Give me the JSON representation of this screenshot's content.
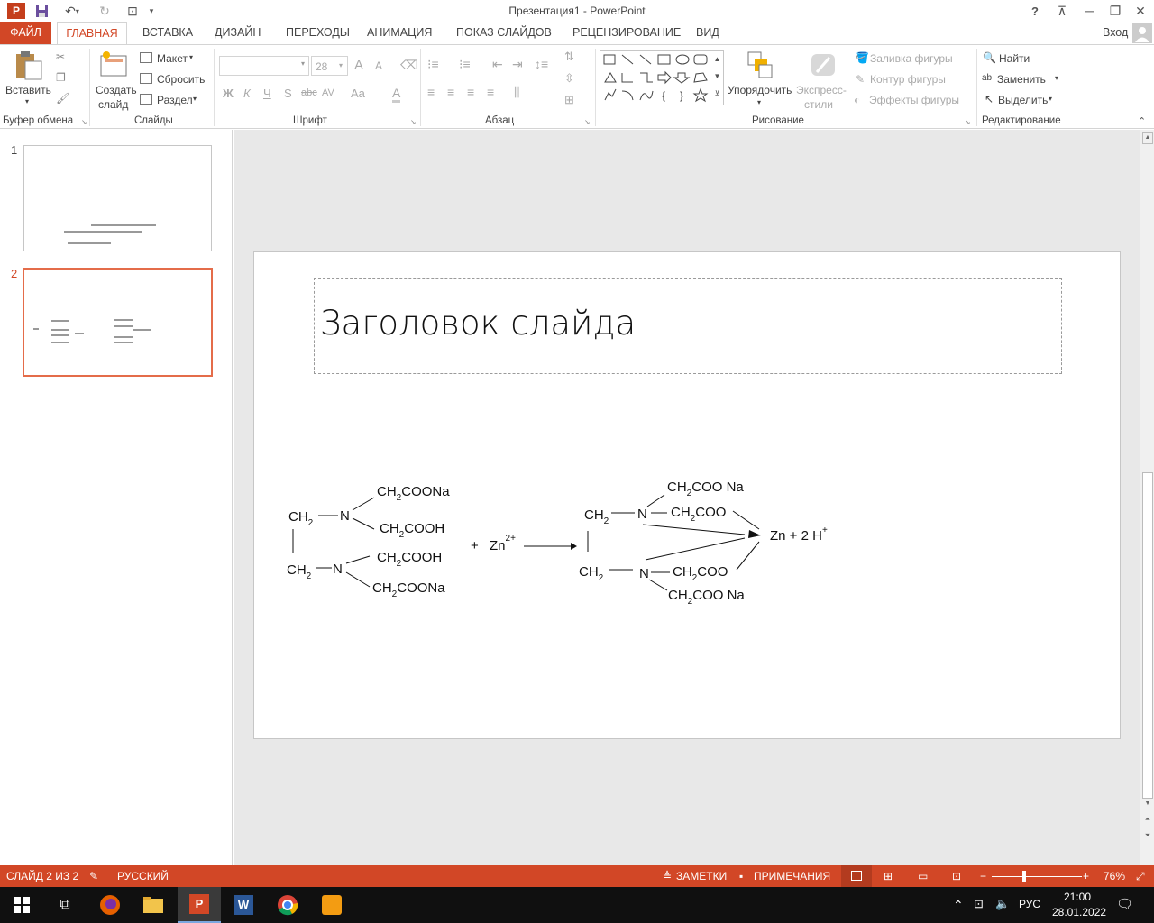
{
  "window": {
    "title": "Презентация1 - PowerPoint",
    "help": "?",
    "minimize": "─",
    "restore": "❐",
    "close": "✕"
  },
  "tabs": {
    "file": "ФАЙЛ",
    "home": "ГЛАВНАЯ",
    "insert": "ВСТАВКА",
    "design": "ДИЗАЙН",
    "transitions": "ПЕРЕХОДЫ",
    "animation": "АНИМАЦИЯ",
    "slideshow": "ПОКАЗ СЛАЙДОВ",
    "review": "РЕЦЕНЗИРОВАНИЕ",
    "view": "ВИД",
    "signin": "Вход"
  },
  "ribbon": {
    "clipboard": {
      "paste": "Вставить",
      "group": "Буфер обмена"
    },
    "slides": {
      "new_slide_1": "Создать",
      "new_slide_2": "слайд",
      "layout": "Макет",
      "reset": "Сбросить",
      "section": "Раздел",
      "group": "Слайды"
    },
    "font": {
      "size": "28",
      "bold": "Ж",
      "italic": "К",
      "underline": "Ч",
      "shadow": "S",
      "strike": "abc",
      "spacing": "AV",
      "case": "Aa",
      "color": "A",
      "grow": "A",
      "shrink": "A",
      "group": "Шрифт"
    },
    "paragraph": {
      "group": "Абзац"
    },
    "drawing": {
      "arrange": "Упорядочить",
      "styles_1": "Экспресс-",
      "styles_2": "стили",
      "fill": "Заливка фигуры",
      "outline": "Контур фигуры",
      "effects": "Эффекты фигуры",
      "group": "Рисование"
    },
    "editing": {
      "find": "Найти",
      "replace": "Заменить",
      "select": "Выделить",
      "group": "Редактирование"
    }
  },
  "thumbnails": {
    "n1": "1",
    "n2": "2"
  },
  "slide": {
    "title": "Заголовок слайда",
    "equation": {
      "ch2": "CH",
      "sub2": "2",
      "n": "N",
      "coona": "COONa",
      "cooh": "COOH",
      "coo": "COO",
      "coo_na": "COO Na",
      "plus": "+",
      "zn": "Zn",
      "zn_charge": "2+",
      "product": "Zn + 2 H",
      "h_charge": "+"
    }
  },
  "status": {
    "slide": "СЛАЙД 2 ИЗ 2",
    "lang": "РУССКИЙ",
    "notes": "ЗАМЕТКИ",
    "comments": "ПРИМЕЧАНИЯ",
    "zoom": "76%"
  },
  "taskbar": {
    "lang": "РУС",
    "time": "21:00",
    "date": "28.01.2022"
  },
  "colors": {
    "accent": "#d24726",
    "taskbar": "#101010"
  }
}
